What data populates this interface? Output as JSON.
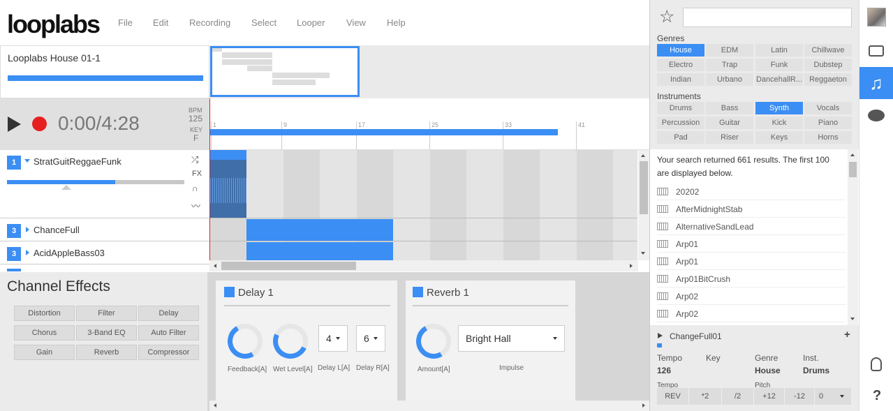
{
  "app": {
    "logo": "looplabs"
  },
  "menu": [
    "File",
    "Edit",
    "Recording",
    "Select",
    "Looper",
    "View",
    "Help"
  ],
  "project": {
    "title": "Looplabs House 01-1"
  },
  "transport": {
    "time": "0:00/4:28",
    "bpm_label": "BPM",
    "bpm": "125",
    "key_label": "KEY",
    "key": "F"
  },
  "timeline": {
    "markers": [
      "1",
      "9",
      "17",
      "25",
      "33",
      "41"
    ]
  },
  "tracks": [
    {
      "num": "1",
      "name": "StratGuitReggaeFunk",
      "volume": 0.65
    },
    {
      "num": "3",
      "name": "ChanceFull"
    },
    {
      "num": "3",
      "name": "AcidAppleBass03"
    }
  ],
  "track_tools": {
    "fx": "FX"
  },
  "channel_effects": {
    "title": "Channel Effects",
    "buttons": [
      "Distortion",
      "Filter",
      "Delay",
      "Chorus",
      "3-Band EQ",
      "Auto Filter",
      "Gain",
      "Reverb",
      "Compressor"
    ]
  },
  "delay": {
    "title": "Delay 1",
    "feedback_label": "Feedback[A]",
    "wet_label": "Wet Level[A]",
    "delay_l_label": "Delay L[A]",
    "delay_r_label": "Delay R[A]",
    "delay_l": "4",
    "delay_r": "6"
  },
  "reverb": {
    "title": "Reverb 1",
    "amount_label": "Amount[A]",
    "impulse_label": "Impulse",
    "impulse": "Bright Hall"
  },
  "browser": {
    "search_placeholder": "",
    "genres_label": "Genres",
    "genres": [
      "House",
      "EDM",
      "Latin",
      "Chillwave",
      "Electro",
      "Trap",
      "Funk",
      "Dubstep",
      "Indian",
      "Urbano",
      "DancehallR...",
      "Reggaeton"
    ],
    "genre_active": "House",
    "instruments_label": "Instruments",
    "instruments": [
      "Drums",
      "Bass",
      "Synth",
      "Vocals",
      "Percussion",
      "Guitar",
      "Kick",
      "Piano",
      "Pad",
      "Riser",
      "Keys",
      "Horns"
    ],
    "instrument_active": "Synth",
    "result_text": "Your search returned 661 results. The first 100 are displayed below.",
    "results": [
      "20202",
      "AfterMidnightStab",
      "AlternativeSandLead",
      "Arp01",
      "Arp01",
      "Arp01BitCrush",
      "Arp02",
      "Arp02"
    ]
  },
  "preview": {
    "name": "ChangeFull01",
    "tempo_label": "Tempo",
    "tempo": "126",
    "key_label": "Key",
    "key": "",
    "genre_label": "Genre",
    "genre": "House",
    "inst_label": "Inst.",
    "inst": "Drums",
    "tempo2_label": "Tempo",
    "pitch_label": "Pitch",
    "buttons": [
      "REV",
      "*2",
      "/2",
      "+12",
      "-12"
    ],
    "pitch_value": "0"
  },
  "colors": {
    "accent": "#3b8ef3",
    "record": "#e62020"
  }
}
